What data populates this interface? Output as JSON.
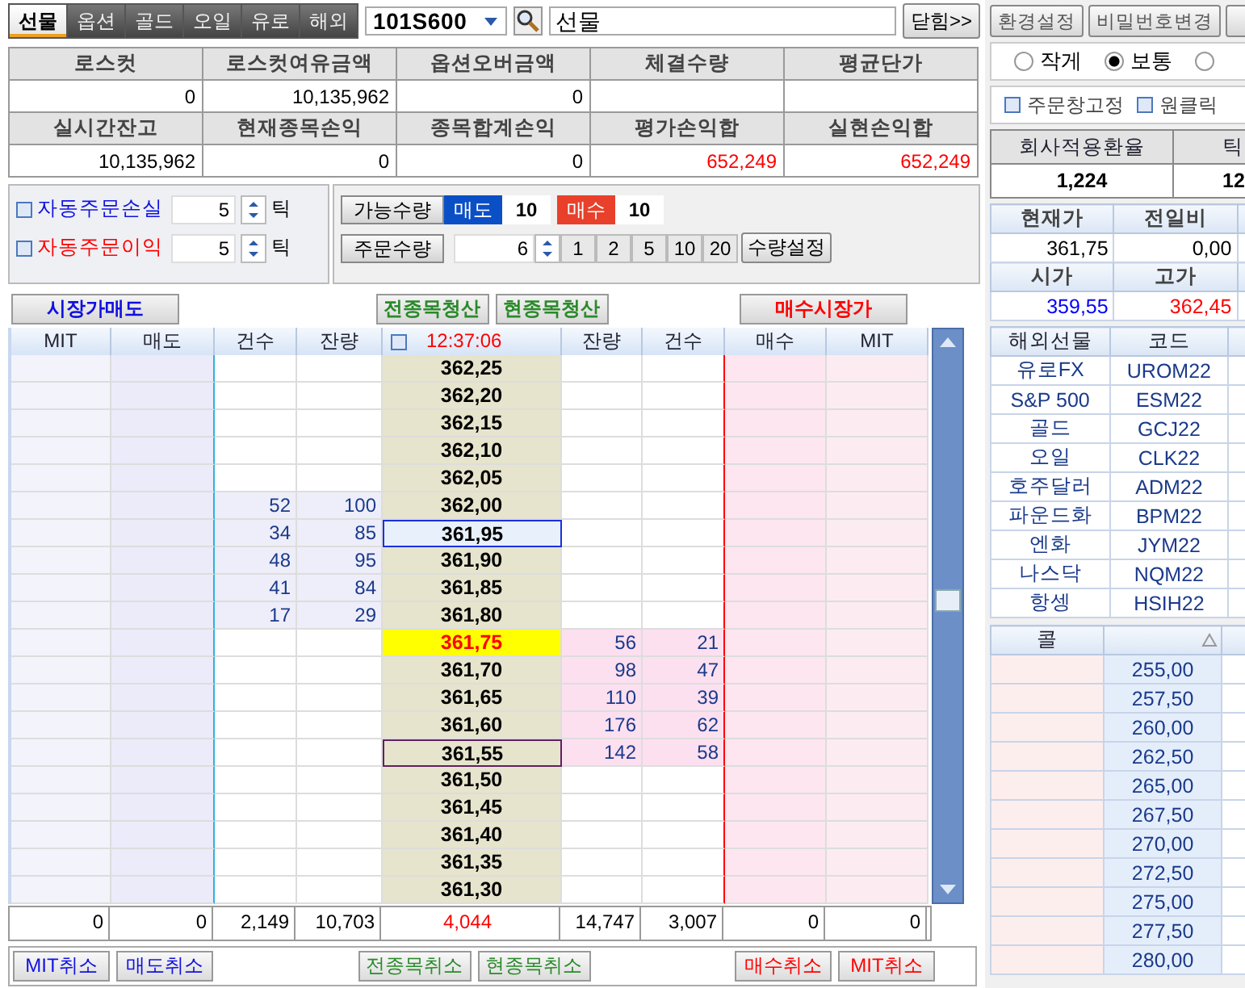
{
  "market_tabs": [
    {
      "label": "선물",
      "selected": true
    },
    {
      "label": "옵션",
      "selected": false
    },
    {
      "label": "골드",
      "selected": false
    },
    {
      "label": "오일",
      "selected": false
    },
    {
      "label": "유로",
      "selected": false
    },
    {
      "label": "해외",
      "selected": false
    }
  ],
  "symbol_combo": {
    "value": "101S600"
  },
  "name_field": {
    "value": "선물"
  },
  "close_button": "닫힘>>",
  "summary": [
    {
      "label": "로스컷",
      "value": "0"
    },
    {
      "label": "로스컷여유금액",
      "value": "10,135,962"
    },
    {
      "label": "옵션오버금액",
      "value": "0"
    },
    {
      "label": "체결수량"
    },
    {
      "label": "평균단가"
    },
    {
      "label": "실시간잔고",
      "value": "10,135,962"
    },
    {
      "label": "현재종목손익",
      "value": "0"
    },
    {
      "label": "종목합계손익",
      "value": "0"
    },
    {
      "label": "평가손익합",
      "value": "652,249",
      "color": "#ff0000"
    },
    {
      "label": "실현손익합",
      "value": "652,249",
      "color": "#ff0000"
    }
  ],
  "auto_orders": [
    {
      "label": "자동주문손실",
      "kind": "loss",
      "checked": false,
      "value": "5",
      "unit": "틱"
    },
    {
      "label": "자동주문이익",
      "kind": "profit",
      "checked": false,
      "value": "5",
      "unit": "틱"
    }
  ],
  "available": {
    "label": "가능수량",
    "sell_label": "매도",
    "sell_value": "10",
    "buy_label": "매수",
    "buy_value": "10"
  },
  "order_qty": {
    "label": "주문수량",
    "value": "6",
    "presets": [
      "1",
      "2",
      "5",
      "10",
      "20"
    ],
    "settings_button": "수량설정"
  },
  "action_buttons": [
    {
      "label": "시장가매도",
      "kind": "sell"
    },
    {
      "label": "전종목청산",
      "kind": "all"
    },
    {
      "label": "현종목청산",
      "kind": "all"
    },
    {
      "label": "매수시장가",
      "kind": "buy"
    }
  ],
  "orderbook": {
    "columns": [
      "MIT",
      "매도",
      "건수",
      "잔량",
      "잔량",
      "건수",
      "매수",
      "MIT"
    ],
    "time": "12:37:06",
    "time_checked": false,
    "rows": [
      {
        "price": "362,25",
        "kind": "normal"
      },
      {
        "price": "362,20",
        "kind": "normal"
      },
      {
        "price": "362,15",
        "kind": "normal"
      },
      {
        "price": "362,10",
        "kind": "normal"
      },
      {
        "price": "362,05",
        "kind": "normal"
      },
      {
        "price": "362,00",
        "kind": "normal",
        "sell_count": "52",
        "sell_qty": "100"
      },
      {
        "price": "361,95",
        "kind": "cursor",
        "sell_count": "34",
        "sell_qty": "85"
      },
      {
        "price": "361,90",
        "kind": "normal",
        "sell_count": "48",
        "sell_qty": "95"
      },
      {
        "price": "361,85",
        "kind": "normal",
        "sell_count": "41",
        "sell_qty": "84"
      },
      {
        "price": "361,80",
        "kind": "normal",
        "sell_count": "17",
        "sell_qty": "29"
      },
      {
        "price": "361,75",
        "kind": "current",
        "buy_qty": "56",
        "buy_count": "21"
      },
      {
        "price": "361,70",
        "kind": "normal",
        "buy_qty": "98",
        "buy_count": "47"
      },
      {
        "price": "361,65",
        "kind": "normal",
        "buy_qty": "110",
        "buy_count": "39"
      },
      {
        "price": "361,60",
        "kind": "normal",
        "buy_qty": "176",
        "buy_count": "62"
      },
      {
        "price": "361,55",
        "kind": "marked",
        "buy_qty": "142",
        "buy_count": "58"
      },
      {
        "price": "361,50",
        "kind": "normal"
      },
      {
        "price": "361,45",
        "kind": "normal"
      },
      {
        "price": "361,40",
        "kind": "normal"
      },
      {
        "price": "361,35",
        "kind": "normal"
      },
      {
        "price": "361,30",
        "kind": "normal"
      }
    ],
    "totals": [
      "0",
      "0",
      "2,149",
      "10,703",
      "4,044",
      "14,747",
      "3,007",
      "0",
      "0"
    ]
  },
  "cancel_buttons": [
    {
      "label": "MIT취소",
      "kind": "sell"
    },
    {
      "label": "매도취소",
      "kind": "sell"
    },
    {
      "label": "전종목취소",
      "kind": "all"
    },
    {
      "label": "현종목취소",
      "kind": "all"
    },
    {
      "label": "매수취소",
      "kind": "buy"
    },
    {
      "label": "MIT취소",
      "kind": "buy"
    }
  ],
  "settings_buttons": [
    "환경설정",
    "비밀번호변경"
  ],
  "size_options": [
    {
      "label": "작게",
      "selected": false
    },
    {
      "label": "보통",
      "selected": true
    },
    {
      "selected": false
    }
  ],
  "window_options": [
    {
      "label": "주문창고정",
      "checked": false
    },
    {
      "label": "원클릭",
      "checked": false
    }
  ],
  "exchange": {
    "columns": [
      "회사적용환율",
      "틱"
    ],
    "values": [
      "1,224",
      "12"
    ]
  },
  "quote": [
    {
      "label": "현재가",
      "value": "361,75"
    },
    {
      "label": "전일비",
      "value": "0,00"
    },
    {
      "label": "시가",
      "value": "359,55",
      "color": "#0000ff"
    },
    {
      "label": "고가",
      "value": "362,45",
      "color": "#ff0000"
    }
  ],
  "overseas": {
    "columns": [
      "해외선물",
      "코드"
    ],
    "rows": [
      {
        "name": "유로FX",
        "code": "UROM22"
      },
      {
        "name": "S&P 500",
        "code": "ESM22"
      },
      {
        "name": "골드",
        "code": "GCJ22"
      },
      {
        "name": "오일",
        "code": "CLK22"
      },
      {
        "name": "호주달러",
        "code": "ADM22"
      },
      {
        "name": "파운드화",
        "code": "BPM22"
      },
      {
        "name": "엔화",
        "code": "JYM22"
      },
      {
        "name": "나스닥",
        "code": "NQM22"
      },
      {
        "name": "항셍",
        "code": "HSIH22"
      }
    ]
  },
  "options_board": {
    "column": "콜",
    "strikes": [
      "255,00",
      "257,50",
      "260,00",
      "262,50",
      "265,00",
      "267,50",
      "270,00",
      "272,50",
      "275,00",
      "277,50",
      "280,00"
    ]
  }
}
